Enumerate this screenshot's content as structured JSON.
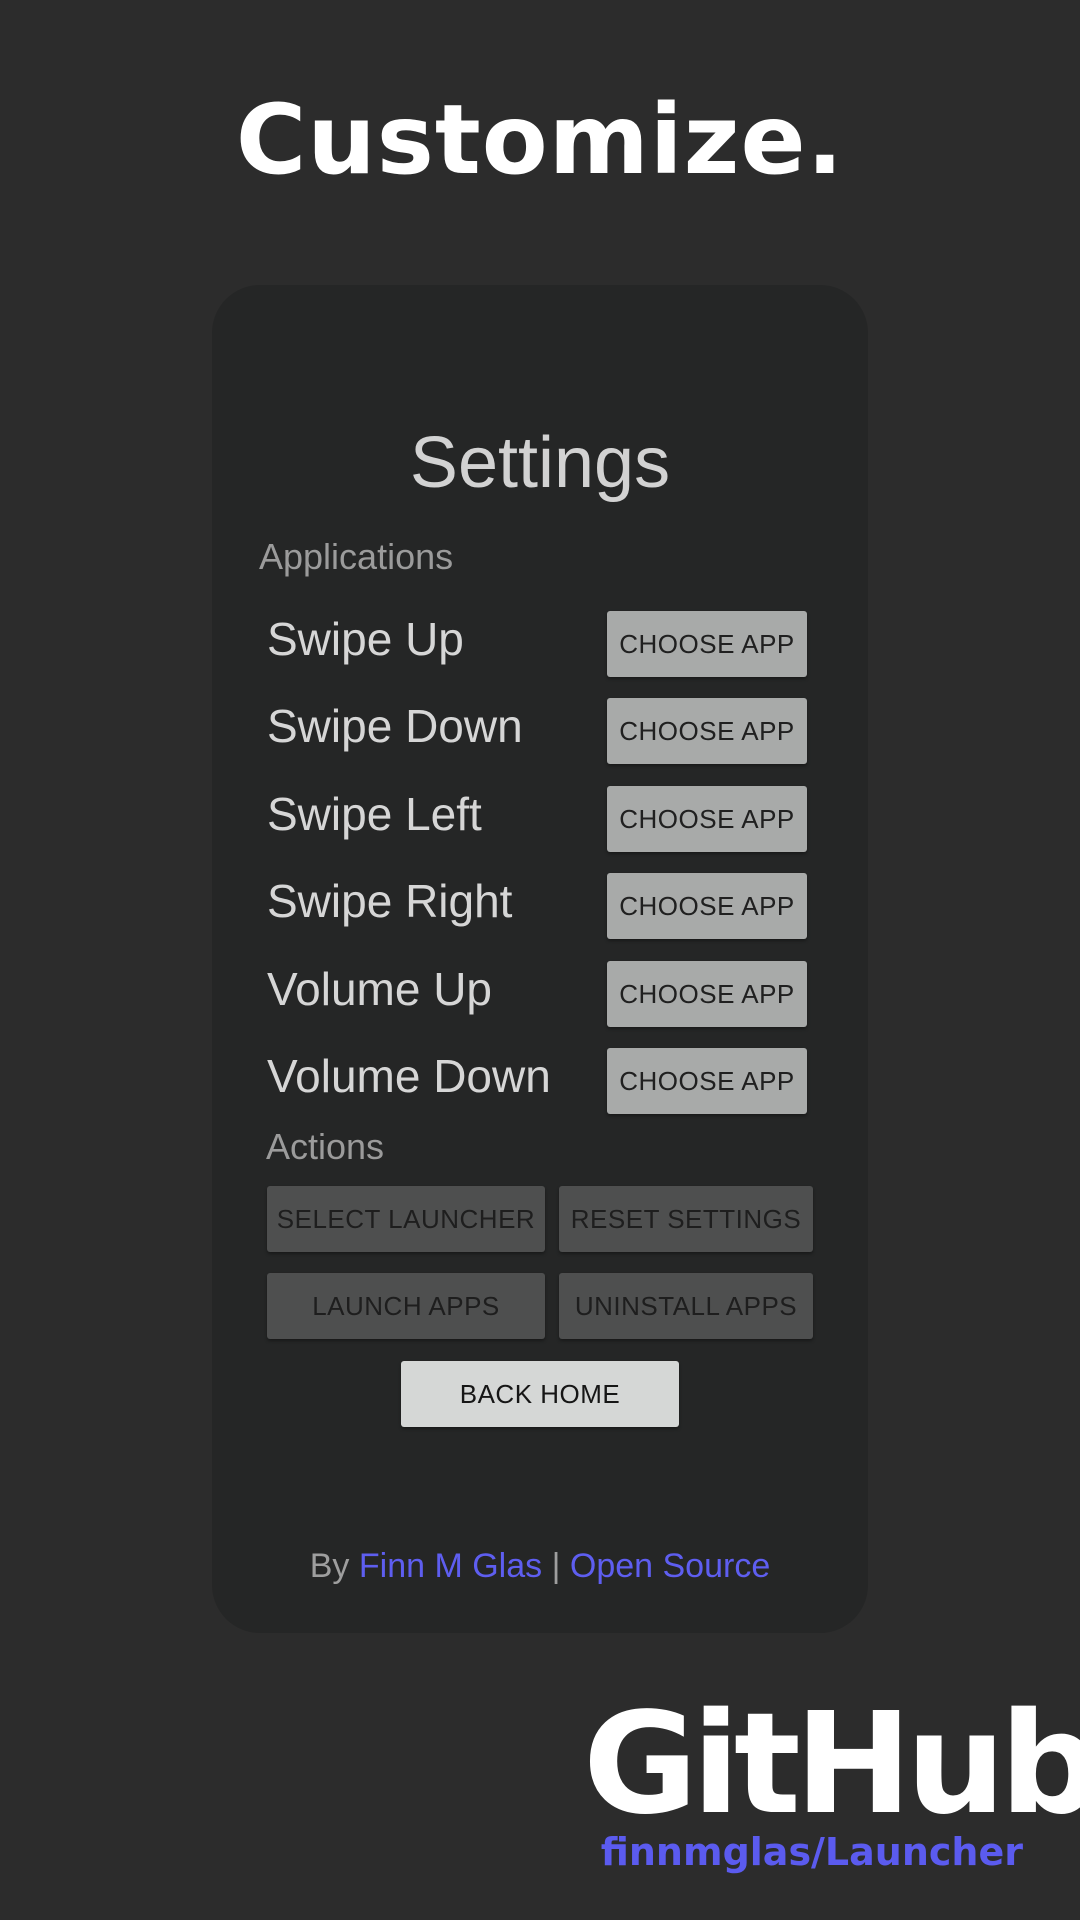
{
  "headline": "Customize.",
  "settings": {
    "title": "Settings",
    "applications_label": "Applications",
    "app_rows": [
      {
        "label": "Swipe Up",
        "button": "CHOOSE APP"
      },
      {
        "label": "Swipe Down",
        "button": "CHOOSE APP"
      },
      {
        "label": "Swipe Left",
        "button": "CHOOSE APP"
      },
      {
        "label": "Swipe Right",
        "button": "CHOOSE APP"
      },
      {
        "label": "Volume Up",
        "button": "CHOOSE APP"
      },
      {
        "label": "Volume Down",
        "button": "CHOOSE APP"
      }
    ],
    "actions_label": "Actions",
    "actions": {
      "select_launcher": "SELECT LAUNCHER",
      "reset_settings": "RESET SETTINGS",
      "launch_apps": "LAUNCH APPS",
      "uninstall_apps": "UNINSTALL APPS",
      "back_home": "BACK HOME"
    },
    "footer": {
      "by": "By ",
      "author": "Finn M Glas",
      "separator": " | ",
      "open_source": "Open Source"
    }
  },
  "github_badge": {
    "word": "GitHub",
    "repo": "finnmglas/Launcher"
  },
  "colors": {
    "background": "#2c2c2c",
    "card": "#252626",
    "link": "#5e5ef0",
    "choose_button": "#a8aaa9",
    "action_button": "#4e4f4f",
    "home_button": "#d5d7d6"
  }
}
